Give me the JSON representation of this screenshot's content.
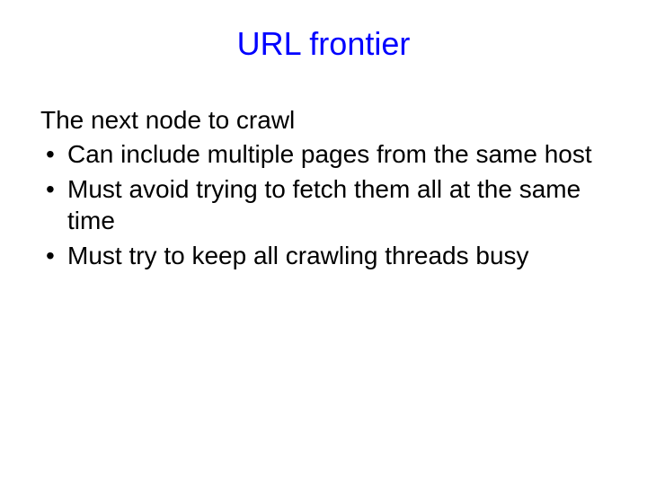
{
  "slide": {
    "title": "URL frontier",
    "subtitle": "The next node to crawl",
    "bullets": [
      "Can include multiple pages from the same host",
      "Must avoid trying to fetch them all at the same time",
      "Must try to keep all crawling threads busy"
    ]
  }
}
